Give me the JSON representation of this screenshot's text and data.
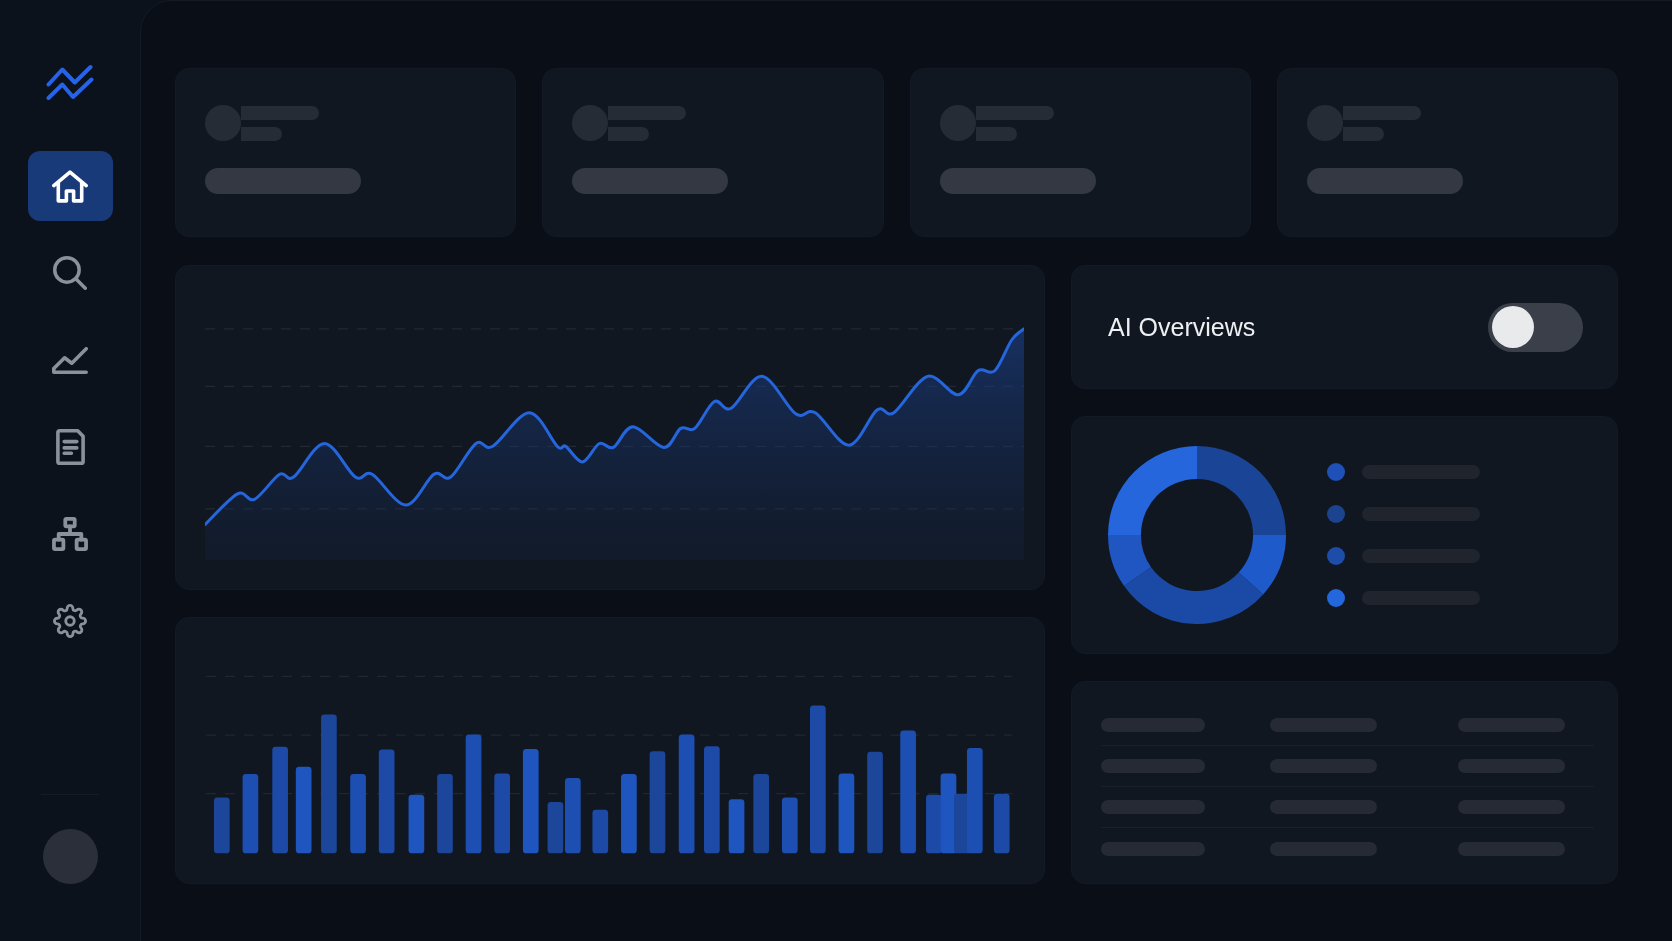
{
  "sidebar": {
    "items": [
      {
        "selected": true
      },
      {
        "selected": false
      },
      {
        "selected": false
      },
      {
        "selected": false
      },
      {
        "selected": false
      },
      {
        "selected": false
      }
    ]
  },
  "stat_cards": [
    {
      "loading": true
    },
    {
      "loading": true
    },
    {
      "loading": true
    },
    {
      "loading": true
    }
  ],
  "toggle_card": {
    "label": "AI Overviews",
    "on": false
  },
  "donut_card": {
    "legend": [
      {
        "color": "#1f50b8",
        "loading": true
      },
      {
        "color": "#1c438e",
        "loading": true
      },
      {
        "color": "#1d4da8",
        "loading": true
      },
      {
        "color": "#2466dc",
        "loading": true
      }
    ]
  },
  "table_card": {
    "loading": true
  }
}
